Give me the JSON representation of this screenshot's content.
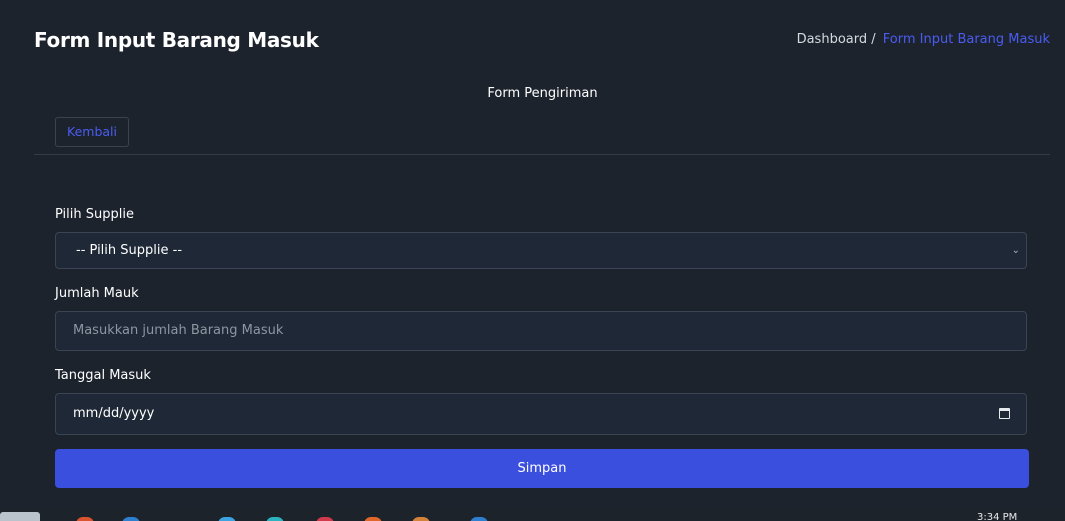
{
  "header": {
    "title": "Form Input Barang Masuk",
    "breadcrumb": {
      "home": "Dashboard",
      "separator": "/",
      "current": "Form Input Barang Masuk"
    }
  },
  "card": {
    "title": "Form Pengiriman",
    "back_label": "Kembali"
  },
  "form": {
    "supplier": {
      "label": "Pilih Supplie",
      "selected": "-- Pilih Supplie --"
    },
    "quantity": {
      "label": "Jumlah Mauk",
      "placeholder": "Masukkan jumlah Barang Masuk",
      "value": ""
    },
    "date": {
      "label": "Tanggal Masuk",
      "placeholder": "mm/dd/yyyy"
    },
    "submit_label": "Simpan"
  },
  "taskbar": {
    "clock": "3:34 PM"
  },
  "colors": {
    "background": "#1c232d",
    "accent": "#3b4fdf",
    "link": "#4a5cf0",
    "input_bg": "#1e2836",
    "input_border": "#3a4452"
  }
}
